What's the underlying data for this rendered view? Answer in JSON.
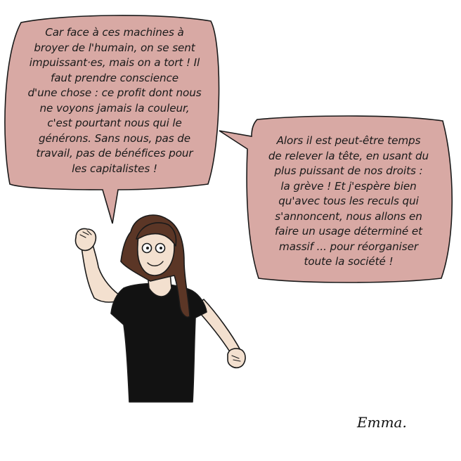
{
  "colors": {
    "bubble_fill": "#d8a9a4",
    "outline": "#1a1a1a",
    "skin": "#f3e0cf",
    "hair": "#5b3626",
    "shirt": "#121212",
    "background": "#ffffff"
  },
  "bubble_left": {
    "lines": [
      "Car face à ces machines à",
      "broyer de l'humain, on se sent",
      "impuissant·es, mais on a tort ! Il",
      "faut prendre conscience",
      "d'une chose : ce profit dont nous",
      "ne voyons jamais la couleur,",
      "c'est pourtant nous qui le",
      "générons. Sans nous, pas de",
      "travail, pas de bénéfices pour",
      "les capitalistes !"
    ]
  },
  "bubble_right": {
    "lines": [
      "Alors il est peut-être temps",
      "de relever la tête, en usant du",
      "plus puissant de nos droits :",
      "la grève ! Et j'espère bien",
      "qu'avec tous les reculs qui",
      "s'annoncent, nous allons en",
      "faire un usage déterminé et",
      "massif ... pour réorganiser",
      "toute la société !"
    ]
  },
  "signature": "Emma."
}
